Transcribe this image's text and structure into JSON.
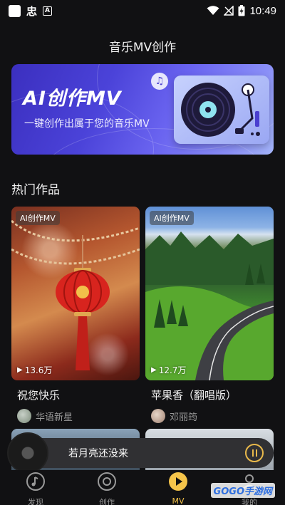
{
  "status_bar": {
    "time": "10:49",
    "app_glyph": "忠",
    "notif_letter": "A"
  },
  "header": {
    "title": "音乐MV创作"
  },
  "banner": {
    "title": "AI创作MV",
    "subtitle": "一键创作出属于您的音乐MV"
  },
  "section": {
    "title": "热门作品"
  },
  "works": [
    {
      "tag": "AI创作MV",
      "plays": "13.6万",
      "title": "祝您快乐",
      "author": "华语新星"
    },
    {
      "tag": "AI创作MV",
      "plays": "12.7万",
      "title": "苹果香（翻唱版）",
      "author": "邓丽筠"
    }
  ],
  "mini_player": {
    "title": "若月亮还没来"
  },
  "tabs": [
    {
      "label": "发现",
      "icon": "music-note-icon"
    },
    {
      "label": "创作",
      "icon": "disc-icon"
    },
    {
      "label": "MV",
      "icon": "play-icon"
    },
    {
      "label": "我的",
      "icon": "profile-icon"
    }
  ],
  "active_tab": "MV",
  "watermark": {
    "text": "GOGO手游网"
  },
  "colors": {
    "accent": "#f5c44a",
    "background": "#111113",
    "banner_start": "#3b2fbf",
    "banner_end": "#a5b6fb"
  }
}
